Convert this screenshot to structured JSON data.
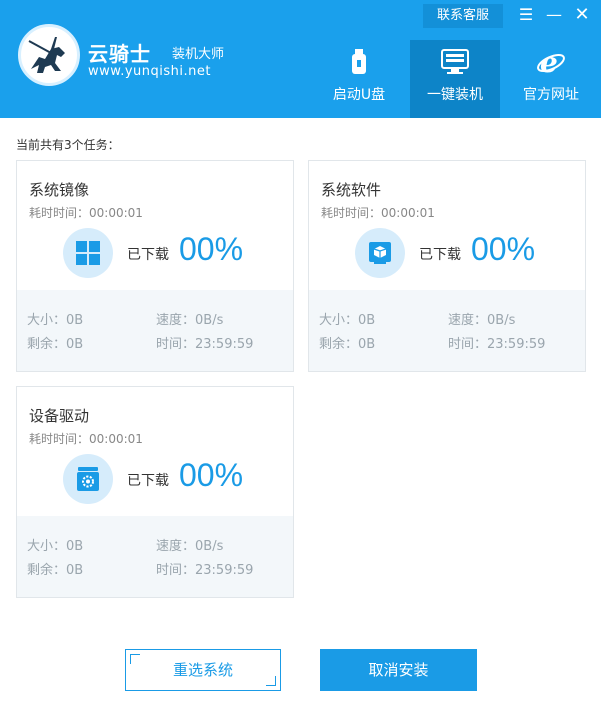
{
  "brand": {
    "name": "云骑士",
    "suffix": "装机大师",
    "url": "www.yunqishi.net"
  },
  "window_controls": {
    "contact_label": "联系客服",
    "menu_glyph": "☰",
    "minimize_glyph": "—",
    "close_glyph": "✕"
  },
  "nav": {
    "items": [
      {
        "label": "启动U盘",
        "icon": "usb-icon"
      },
      {
        "label": "一键装机",
        "icon": "install-icon",
        "active": true
      },
      {
        "label": "官方网址",
        "icon": "ie-icon"
      }
    ]
  },
  "task_summary": "当前共有3个任务：",
  "tasks": [
    {
      "title": "系统镜像",
      "elapsed": "耗时时间：00:00:01",
      "icon": "windows-icon",
      "downloaded_label": "已下载",
      "percent": "00%",
      "size": "大小：0B",
      "remaining": "剩余：0B",
      "speed": "速度：0B/s",
      "time": "时间：23:59:59"
    },
    {
      "title": "系统软件",
      "elapsed": "耗时时间：00:00:01",
      "icon": "software-box-icon",
      "downloaded_label": "已下载",
      "percent": "00%",
      "size": "大小：0B",
      "remaining": "剩余：0B",
      "speed": "速度：0B/s",
      "time": "时间：23:59:59"
    },
    {
      "title": "设备驱动",
      "elapsed": "耗时时间：00:00:01",
      "icon": "driver-gear-icon",
      "downloaded_label": "已下载",
      "percent": "00%",
      "size": "大小：0B",
      "remaining": "剩余：0B",
      "speed": "速度：0B/s",
      "time": "时间：23:59:59"
    }
  ],
  "buttons": {
    "reselect": "重选系统",
    "cancel": "取消安装"
  },
  "colors": {
    "header_bg": "#1aa0ec",
    "nav_active_bg": "#0d84c8",
    "accent": "#1a9be6",
    "card_footer_bg": "#f3f7fa"
  }
}
